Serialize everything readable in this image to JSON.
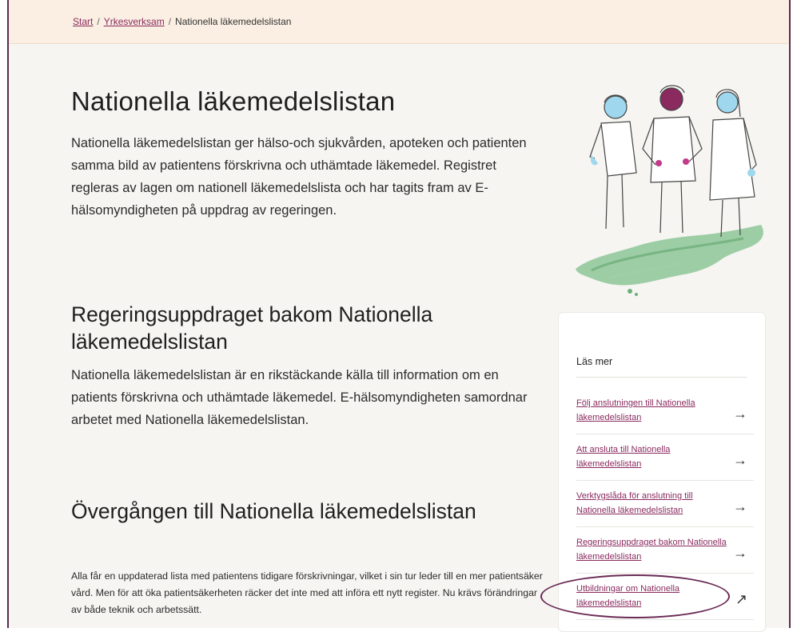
{
  "breadcrumb": {
    "items": [
      "Start",
      "Yrkesverksam",
      "Nationella läkemedelslistan"
    ],
    "separator": "/"
  },
  "page": {
    "title": "Nationella läkemedelslistan",
    "intro": "Nationella läkemedelslistan ger hälso-och sjukvården, apoteken och patienten samma bild av patientens förskrivna och uthämtade läkemedel. Registret regleras av lagen om nationell läkemedelslista och har tagits fram av E-hälsomyndigheten på uppdrag av regeringen."
  },
  "sections": [
    {
      "heading": "Regeringsuppdraget bakom Nationella läkemedelslistan",
      "text": "Nationella läkemedelslistan är en rikstäckande källa till information om en patients förskrivna och uthämtade läkemedel. E-hälsomyndigheten samordnar arbetet med Nationella läkemedelslistan."
    },
    {
      "heading": "Övergången till Nationella läkemedelslistan",
      "text": "Alla får en uppdaterad lista med patientens tidigare förskrivningar, vilket i sin tur leder till en mer patientsäker vård. Men för att öka patientsäkerheten räcker det inte med att införa ett nytt register. Nu krävs förändringar av både teknik och arbetssätt."
    }
  ],
  "sidebar": {
    "title": "Läs mer",
    "links": [
      {
        "label": "Följ anslutningen till Nationella läkemedelslistan",
        "icon": "arrow-right-icon",
        "glyph": "→"
      },
      {
        "label": "Att ansluta till Nationella läkemedelslistan",
        "icon": "arrow-right-icon",
        "glyph": "→"
      },
      {
        "label": "Verktygslåda för anslutning till Nationella läkemedelslistan",
        "icon": "arrow-right-icon",
        "glyph": "→"
      },
      {
        "label": "Regeringsuppdraget bakom Nationella läkemedelslistan",
        "icon": "arrow-right-icon",
        "glyph": "→"
      },
      {
        "label": "Utbildningar om Nationella läkemedelslistan",
        "icon": "external-link-icon",
        "glyph": "↗"
      }
    ]
  },
  "colors": {
    "accent": "#8a2a5f",
    "breadcrumb_bg": "#faefe2",
    "page_bg": "#f6f5f2",
    "highlight_ellipse": "#6a2a55"
  }
}
